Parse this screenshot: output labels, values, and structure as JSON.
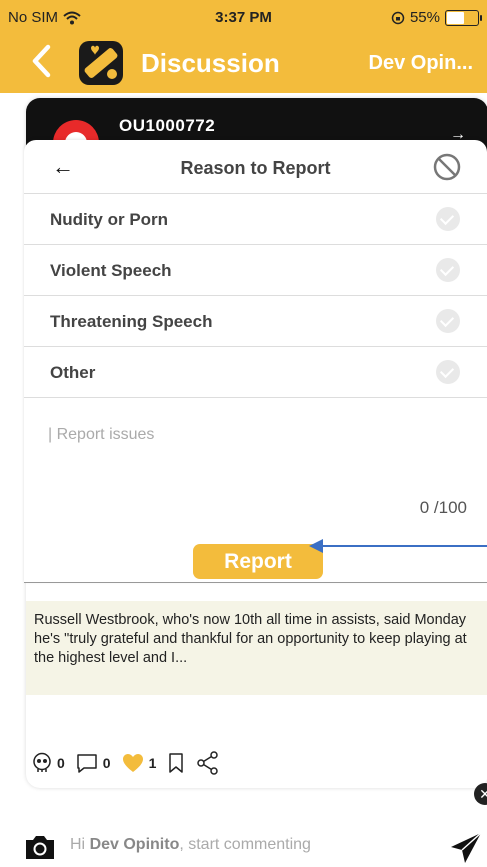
{
  "status": {
    "carrier": "No SIM",
    "time": "3:37 PM",
    "battery": "55%",
    "battery_level": 0.55
  },
  "nav": {
    "title": "Discussion",
    "right_label": "Dev Opin..."
  },
  "post": {
    "username": "OU1000772",
    "snippet": "Russell Westbrook, who's now 10th all time in assists, said Monday he's \"truly grateful and thankful for an opportunity to keep playing at the highest level and I...",
    "counts": {
      "skull": "0",
      "comments": "0",
      "likes": "1"
    }
  },
  "modal": {
    "title": "Reason to Report",
    "reasons": [
      "Nudity or Porn",
      "Violent Speech",
      "Threatening Speech",
      "Other"
    ],
    "issues_placeholder": "| Report issues",
    "counter": "0 /100",
    "report_label": "Report"
  },
  "comment": {
    "prefix": "Hi ",
    "name": "Dev Opinito",
    "suffix": ", start commenting"
  },
  "colors": {
    "brand": "#f3bc3c",
    "annotation": "#3b6fc4"
  }
}
